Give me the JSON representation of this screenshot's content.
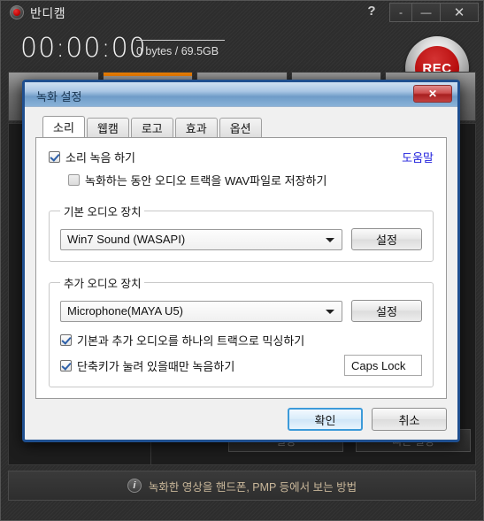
{
  "app": {
    "title": "반디캠",
    "logo_icon": "record-dot-icon",
    "help_label": "?",
    "window_buttons": [
      {
        "name": "restore",
        "label": "-"
      },
      {
        "name": "minimize",
        "label": "—"
      },
      {
        "name": "close",
        "label": "✕"
      }
    ],
    "timer": "00:00:00",
    "storage": "0 bytes / 69.5GB",
    "rec_label": "REC",
    "toolbar_tabs": [
      {
        "name": "screen",
        "glyph": "▭",
        "active": false
      },
      {
        "name": "rectangle",
        "glyph": "▣",
        "active": true
      },
      {
        "name": "fullscreen",
        "glyph": "⬜",
        "active": false
      },
      {
        "name": "device",
        "glyph": "▬",
        "active": false
      },
      {
        "name": "game",
        "glyph": "◆",
        "active": false
      }
    ],
    "panel_buttons": [
      {
        "name": "settings",
        "label": "설정"
      },
      {
        "name": "quick-settings",
        "label": "빠른 설정"
      }
    ],
    "info_icon": "info-icon",
    "info_text": "녹화한 영상을 핸드폰, PMP 등에서 보는 방법"
  },
  "dialog": {
    "title": "녹화 설정",
    "close_label": "✕",
    "tabs": [
      {
        "label": "소리",
        "active": true
      },
      {
        "label": "웹캠",
        "active": false
      },
      {
        "label": "로고",
        "active": false
      },
      {
        "label": "효과",
        "active": false
      },
      {
        "label": "옵션",
        "active": false
      }
    ],
    "help_link": "도움말",
    "record_sound": {
      "label": "소리 녹음 하기",
      "checked": true
    },
    "save_wav": {
      "label": "녹화하는 동안 오디오 트랙을 WAV파일로 저장하기",
      "checked": false,
      "disabled": true
    },
    "primary_device": {
      "legend": "기본 오디오 장치",
      "value": "Win7 Sound (WASAPI)",
      "button": "설정"
    },
    "secondary_device": {
      "legend": "추가 오디오 장치",
      "value": "Microphone(MAYA U5)",
      "button": "설정",
      "mix_tracks": {
        "label": "기본과 추가 오디오를 하나의 트랙으로 믹싱하기",
        "checked": true
      },
      "push_to_talk": {
        "label": "단축키가 눌려 있을때만 녹음하기",
        "checked": true,
        "hotkey": "Caps Lock"
      }
    },
    "ok_label": "확인",
    "cancel_label": "취소"
  }
}
